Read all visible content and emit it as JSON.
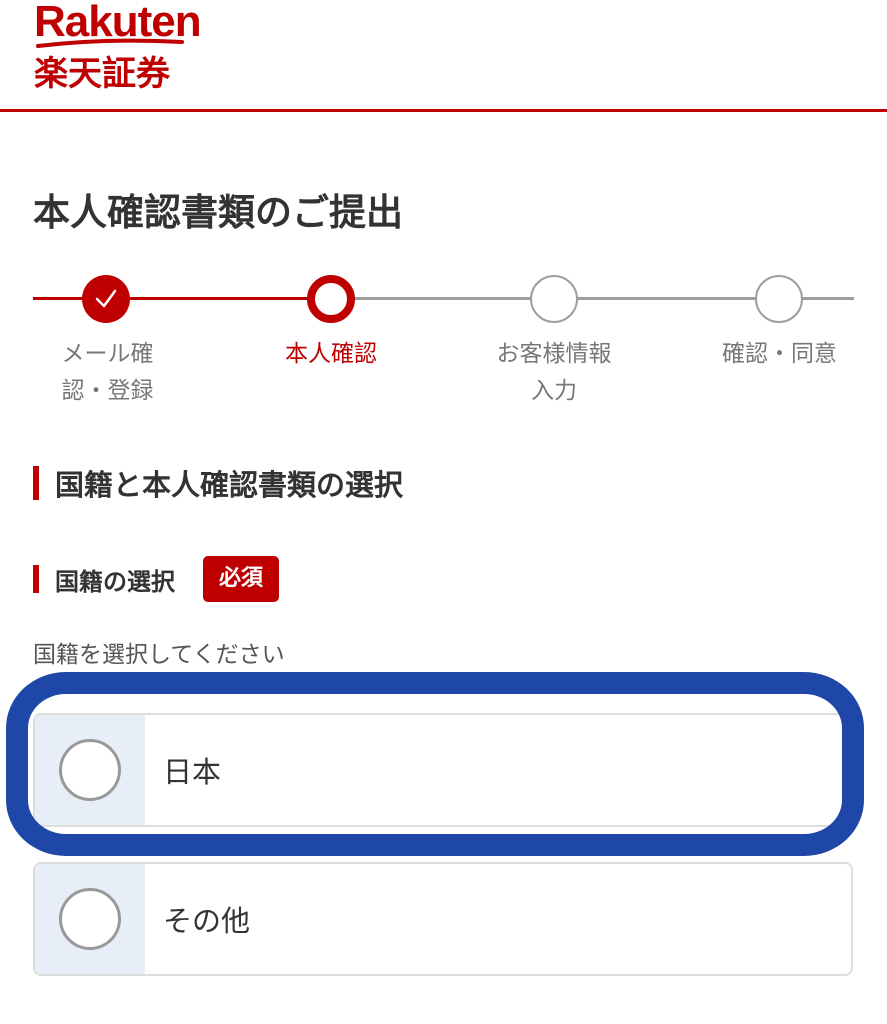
{
  "brand": {
    "logo_en": "Rakuten",
    "logo_jp": "楽天証券",
    "accent_color": "#bf0000"
  },
  "page": {
    "title": "本人確認書類のご提出"
  },
  "stepper": {
    "steps": [
      {
        "label_line1": "メール確",
        "label_line2": "認・登録",
        "state": "done"
      },
      {
        "label_line1": "本人確認",
        "label_line2": "",
        "state": "current"
      },
      {
        "label_line1": "お客様情報",
        "label_line2": "入力",
        "state": "todo"
      },
      {
        "label_line1": "確認・同意",
        "label_line2": "",
        "state": "todo"
      }
    ]
  },
  "section": {
    "heading": "国籍と本人確認書類の選択"
  },
  "nationality": {
    "heading": "国籍の選択",
    "required_badge": "必須",
    "hint": "国籍を選択してください",
    "options": [
      {
        "label": "日本",
        "selected": false
      },
      {
        "label": "その他",
        "selected": false
      }
    ]
  },
  "annotation": {
    "highlight_color": "#1f47a8"
  }
}
